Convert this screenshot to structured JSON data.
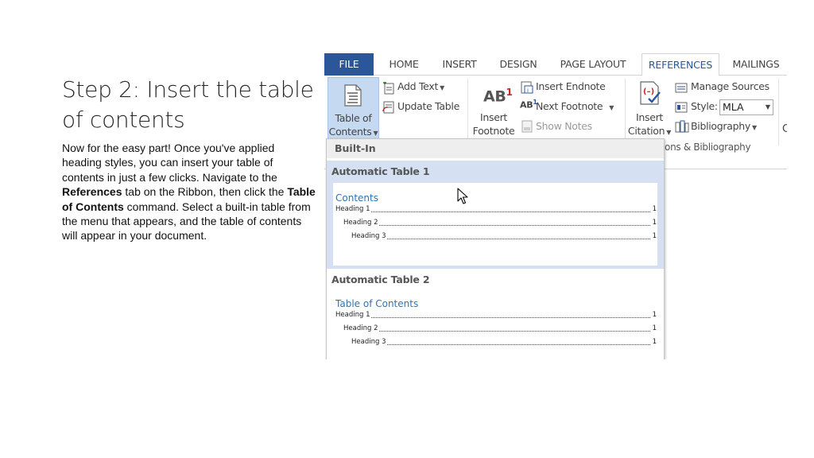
{
  "slide": {
    "title": "Step 2: Insert the table of contents",
    "body": {
      "p1": "Now for the easy part! Once you've applied heading styles, you can insert your table of contents in just a few clicks. Navigate to the ",
      "b1": "References",
      "p2": " tab on the Ribbon, then click the ",
      "b2": "Table of Contents",
      "p3": " command. Select a built-in table from the menu that appears, and the table of contents will appear in your document."
    }
  },
  "tabs": [
    "FILE",
    "HOME",
    "INSERT",
    "DESIGN",
    "PAGE LAYOUT",
    "REFERENCES",
    "MAILINGS"
  ],
  "active_tab": "REFERENCES",
  "ribbon": {
    "toc": {
      "line1": "Table of",
      "line2": "Contents"
    },
    "add_text": "Add Text",
    "update_table": "Update Table",
    "ab_glyph": "AB",
    "ab_sup": "1",
    "insert_footnote": {
      "line1": "Insert",
      "line2": "Footnote"
    },
    "insert_endnote": "Insert Endnote",
    "next_footnote": "Next Footnote",
    "show_notes": "Show Notes",
    "insert_citation": {
      "line1": "Insert",
      "line2": "Citation"
    },
    "manage_sources": "Manage Sources",
    "style_label": "Style:",
    "style_value": "MLA",
    "bibliography": "Bibliography",
    "group_label": "ions & Bibliography",
    "partial_char": "C"
  },
  "menu": {
    "header": "Built-In",
    "options": [
      {
        "title": "Automatic Table 1",
        "preview_title": "Contents",
        "lines": [
          {
            "label": "Heading 1",
            "page": "1"
          },
          {
            "label": "Heading 2",
            "page": "1"
          },
          {
            "label": "Heading 3",
            "page": "1"
          }
        ]
      },
      {
        "title": "Automatic Table 2",
        "preview_title": "Table of Contents",
        "lines": [
          {
            "label": "Heading 1",
            "page": "1"
          },
          {
            "label": "Heading 2",
            "page": "1"
          },
          {
            "label": "Heading 3",
            "page": "1"
          }
        ]
      }
    ]
  },
  "colors": {
    "file_tab": "#2b579a",
    "accent": "#2b579a",
    "hover": "#d5e1f2",
    "preview_title": "#2e74b5"
  }
}
